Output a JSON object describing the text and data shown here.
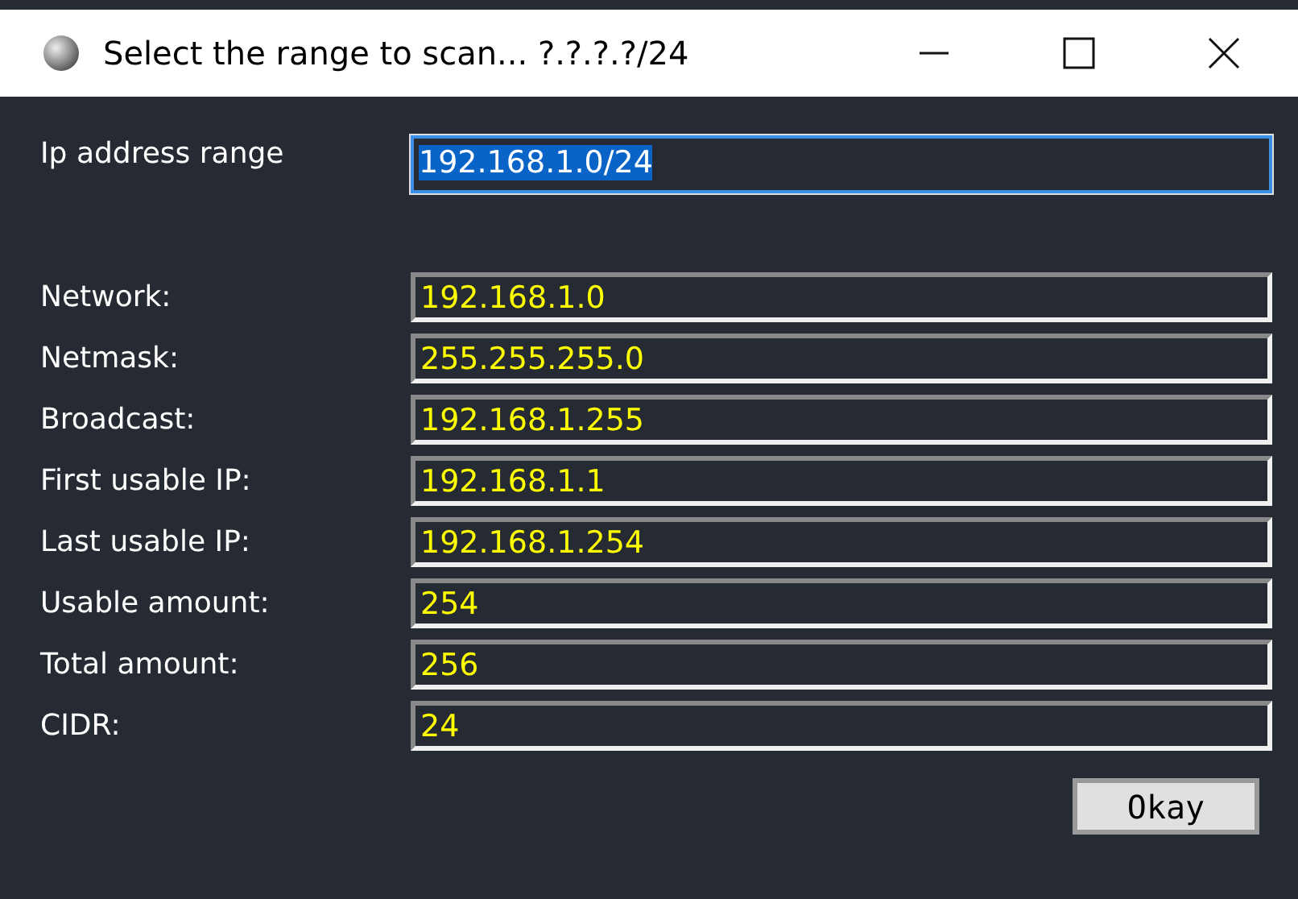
{
  "window": {
    "title": "Select the range to scan... ?.?.?.?/24"
  },
  "range": {
    "label": "Ip address range",
    "value": "192.168.1.0/24",
    "selected": true
  },
  "results": [
    {
      "label": "Network:",
      "value": "192.168.1.0"
    },
    {
      "label": "Netmask:",
      "value": "255.255.255.0"
    },
    {
      "label": "Broadcast:",
      "value": "192.168.1.255"
    },
    {
      "label": "First usable IP:",
      "value": "192.168.1.1"
    },
    {
      "label": "Last usable IP:",
      "value": "192.168.1.254"
    },
    {
      "label": "Usable amount:",
      "value": "254"
    },
    {
      "label": "Total amount:",
      "value": "256"
    },
    {
      "label": "CIDR:",
      "value": "24"
    }
  ],
  "buttons": [
    "Okay"
  ]
}
